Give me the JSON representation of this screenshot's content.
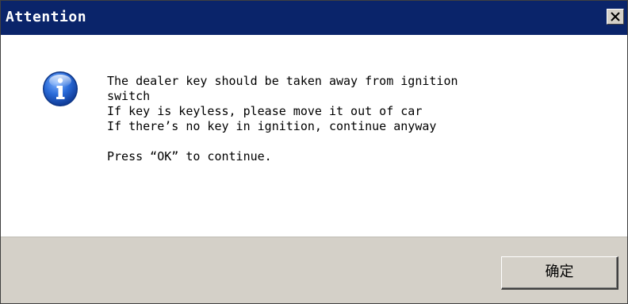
{
  "dialog": {
    "title": "Attention",
    "close_icon": "close-icon",
    "info_icon": "info-icon",
    "message_lines": [
      "The dealer key should be taken away from ignition",
      "switch",
      "If key is keyless, please move it out of car",
      "If there’s no key in ignition, continue anyway",
      "",
      "Press “OK” to continue."
    ],
    "ok_label": "确定"
  },
  "colors": {
    "titlebar": "#0a246a",
    "title_text": "#ffffff",
    "button_face": "#d4d0c8",
    "content_bg": "#ffffff",
    "icon_blue": "#1f5fc4"
  }
}
